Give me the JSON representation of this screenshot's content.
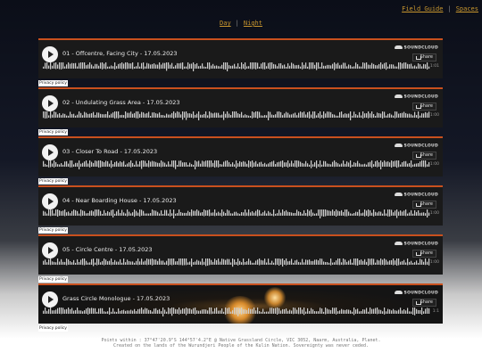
{
  "nav": {
    "field_guide": "Field Guide",
    "separator": "|",
    "spaces": "Spaces"
  },
  "modes": {
    "day": "Day",
    "separator": "|",
    "night": "Night"
  },
  "player": {
    "soundcloud_label": "SOUNDCLOUD",
    "share_label": "Share",
    "privacy_label": "Privacy policy"
  },
  "tracks": [
    {
      "title": "01 - Offcentre, Facing City - 17.05.2023",
      "duration": "1:01"
    },
    {
      "title": "02 - Undulating Grass Area - 17.05.2023",
      "duration": "1:00"
    },
    {
      "title": "03 - Closer To Road - 17.05.2023",
      "duration": "1:00"
    },
    {
      "title": "04 - Near Boarding House - 17.05.2023",
      "duration": "1:00"
    },
    {
      "title": "05 - Circle Centre - 17.05.2023",
      "duration": "1:00"
    },
    {
      "title": "Grass Circle Monologue - 17.05.2023",
      "duration": "1:1"
    }
  ],
  "footer": {
    "line1": "Points within : 37°47'20.9\"S 144°57'4.2\"E @ Native Grassland Circle, VIC 3052, Naarm, Australia, Planet.",
    "line2": "Created on the lands of the Wurundjeri People of the Kulin Nation. Sovereignty was never ceded."
  },
  "colors": {
    "accent": "#c9501e",
    "link": "#c8962e"
  }
}
